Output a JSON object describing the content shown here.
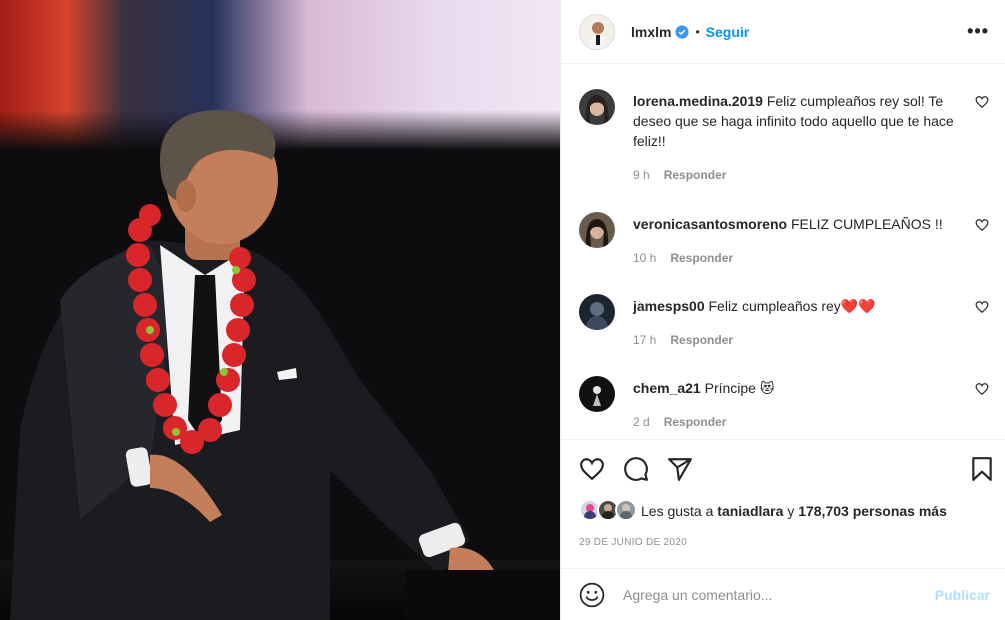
{
  "post": {
    "photo_icon": "concert-photo",
    "author": {
      "username": "lmxlm",
      "verified": true,
      "follow_label": "Seguir",
      "more_icon": "more-horizontal-icon"
    },
    "comments": [
      {
        "username": "lorena.medina.2019",
        "text": "Feliz cumpleaños rey sol! Te deseo que se haga infinito todo aquello que te hace feliz!!",
        "time": "9 h",
        "reply_label": "Responder"
      },
      {
        "username": "veronicasantosmoreno",
        "text": "FELIZ CUMPLEAÑOS !!",
        "time": "10 h",
        "reply_label": "Responder"
      },
      {
        "username": "jamesps00",
        "text": "Feliz cumpleaños rey❤️❤️",
        "time": "17 h",
        "reply_label": "Responder"
      },
      {
        "username": "chem_a21",
        "text": "Príncipe 😻",
        "time": "2 d",
        "reply_label": "Responder"
      }
    ],
    "likes": {
      "prefix": "Les gusta a",
      "user": "taniadlara",
      "conjunction": "y",
      "others": "178,703 personas más"
    },
    "date": "29 DE JUNIO DE 2020",
    "add_comment": {
      "placeholder": "Agrega un comentario...",
      "publish_label": "Publicar"
    }
  },
  "colors": {
    "accent": "#0095f6",
    "publish_disabled": "#b2dffc",
    "muted": "#8e8e8e",
    "text": "#262626",
    "heart": "#ed4956"
  }
}
